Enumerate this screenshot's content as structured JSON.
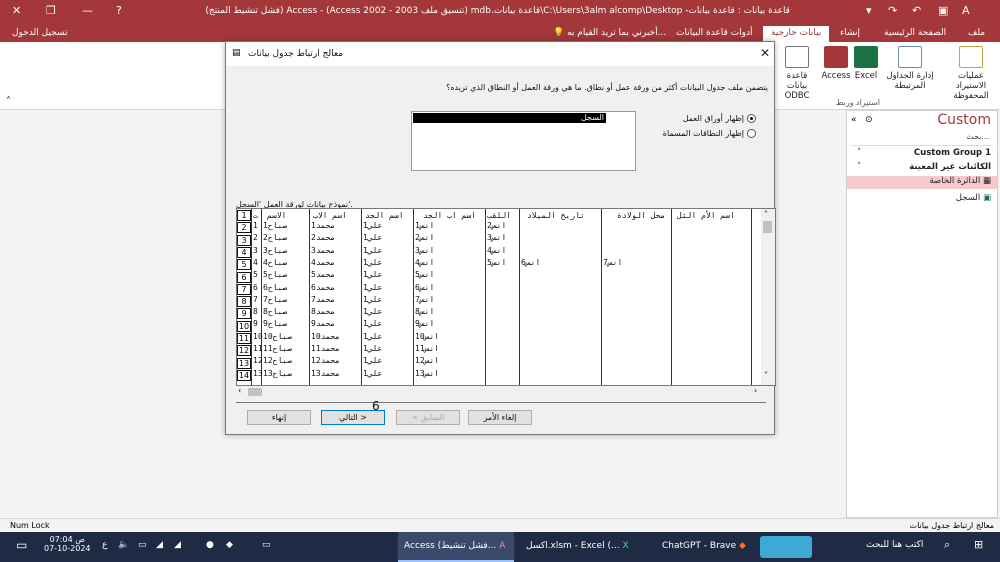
{
  "window": {
    "title": "قاعدة بيانات : قاعدة بيانات- C:\\Users\\3alm alcomp\\Desktop\\قاعدة بيانات.mdb (تنسيق ملف Access 2002 - 2003) - Access (فشل تنشيط المنتج)",
    "signin": "تسجيل الدخول"
  },
  "ribbon_tabs": [
    "ملف",
    "الصفحة الرئيسية",
    "إنشاء",
    "بيانات خارجية",
    "أدوات قاعدة البيانات"
  ],
  "tell_me": "أخبرني بما تريد القيام به...",
  "ribbon": {
    "buttons": [
      "عمليات الاستيراد المحفوظة",
      "إدارة الجداول المرتبطة",
      "Excel",
      "Access",
      "قاعدة بيانات ODBC"
    ],
    "group_label": "استيراد وربط"
  },
  "nav": {
    "title": "Custom",
    "search": "بحث...",
    "group1": "Custom Group 1",
    "group2": "الكائنات غير المعينة",
    "item1": "الدائرة الخاصة",
    "item2": "السجل"
  },
  "dialog": {
    "title": "معالج ارتباط جدول بيانات",
    "close": "✕",
    "question": "يتضمن ملف جدول البيانات أكثر من ورقة عمل أو نطاق. ما هي ورقة العمل أو النطاق الذي تريده؟",
    "sheet_selected": "السجل",
    "radio_sheets": "إظهار أوراق العمل",
    "radio_ranges": "إظهار النطاقات المسماة",
    "preview_label": "نموذج بيانات لورقة العمل 'السجل'.",
    "btn_cancel": "إلغاء الأمر",
    "btn_back": "< السابق",
    "btn_next": "التالي >",
    "btn_finish": "إنهاء",
    "annotation": "6"
  },
  "grid": {
    "headers": [
      "ت",
      "الاسم",
      "اسم الاب",
      "اسم الجد",
      "اسم اب الجد",
      "اللقب",
      "تاريخ الميلاد",
      "محل الولادة",
      "اسم الأم الثل"
    ],
    "rownums": [
      "1",
      "2",
      "3",
      "4",
      "5",
      "6",
      "7",
      "8",
      "9",
      "10",
      "11",
      "12",
      "13",
      "14"
    ],
    "col_t": [
      "1",
      "2",
      "3",
      "4",
      "5",
      "6",
      "7",
      "8",
      "9",
      "10",
      "11",
      "12",
      "13"
    ],
    "col_name": [
      "صباح1",
      "صباح2",
      "صباح3",
      "صباح4",
      "صباح5",
      "صباح6",
      "صباح7",
      "صباح8",
      "صباح9",
      "صباح10",
      "صباح11",
      "صباح12",
      "صباح13"
    ],
    "col_father": [
      "محمد1",
      "محمد2",
      "محمد3",
      "محمد4",
      "محمد5",
      "محمد6",
      "محمد7",
      "محمد8",
      "محمد9",
      "محمد10",
      "محمد11",
      "محمد12",
      "محمد13"
    ],
    "col_grand": [
      "علي1",
      "علي1",
      "علي1",
      "علي1",
      "علي1",
      "علي1",
      "علي1",
      "علي1",
      "علي1",
      "علي1",
      "علي1",
      "علي1",
      "علي1"
    ],
    "col_greatgrand": [
      "انس1",
      "انس2",
      "انس3",
      "انس4",
      "انس5",
      "انس6",
      "انس7",
      "انس8",
      "انس9",
      "انس10",
      "انس11",
      "انس12",
      "انس13"
    ],
    "col_surname": [
      "انس2",
      "انس3",
      "انس4",
      "انس5"
    ],
    "col_birthdate": [
      "انس6"
    ],
    "col_birthplace": [
      "انس7"
    ]
  },
  "status": {
    "left": "Num Lock",
    "right": "معالج ارتباط جدول بيانات"
  },
  "taskbar": {
    "search": "اكتب هنا للبحث",
    "apps": [
      "ChatGPT - Brave",
      "اكسل.xlsm - Excel (...",
      "Access (فشل تنشيط..."
    ],
    "time": "07:04 ص",
    "date": "07-10-2024",
    "lang": "ع"
  }
}
